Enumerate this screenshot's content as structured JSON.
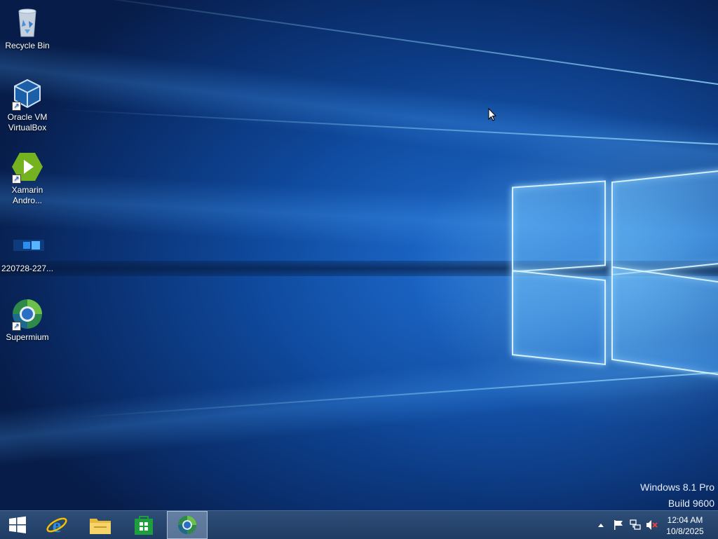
{
  "desktop": {
    "icons": [
      {
        "label": "Recycle Bin",
        "icon": "recycle-bin-icon"
      },
      {
        "label": "Oracle VM\nVirtualBox",
        "icon": "virtualbox-icon"
      },
      {
        "label": "Xamarin\nAndro...",
        "icon": "xamarin-icon"
      },
      {
        "label": "220728-227...",
        "icon": "windows-logo-file-icon"
      },
      {
        "label": "Supermium",
        "icon": "supermium-icon"
      }
    ]
  },
  "watermark": {
    "line1": "Windows 8.1 Pro",
    "line2": "Build 9600"
  },
  "taskbar": {
    "start_icon": "windows-start-icon",
    "pinned": [
      {
        "name": "internet-explorer",
        "icon": "internet-explorer-icon"
      },
      {
        "name": "file-explorer",
        "icon": "file-explorer-icon"
      },
      {
        "name": "store",
        "icon": "store-icon"
      },
      {
        "name": "supermium",
        "icon": "supermium-icon",
        "active": true
      }
    ],
    "tray": {
      "icons": [
        "show-hidden-icons-chevron",
        "action-center-flag-icon",
        "network-icon",
        "volume-muted-icon"
      ],
      "time": "12:04 AM",
      "date": "10/8/2025"
    }
  },
  "colors": {
    "taskbar": "#24446d",
    "wallpaper_accent": "#1a64c4"
  }
}
